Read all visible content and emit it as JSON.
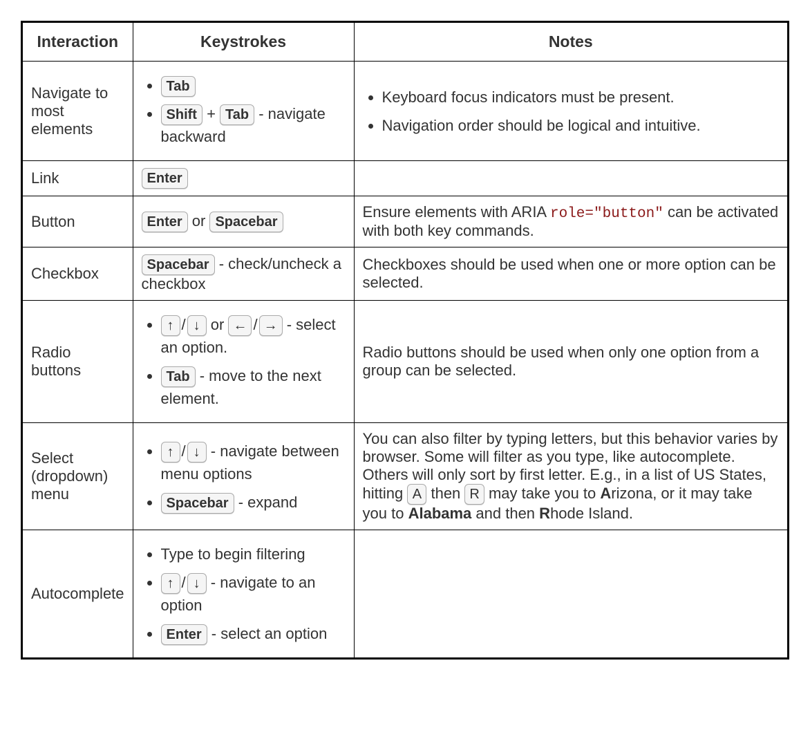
{
  "headers": {
    "interaction": "Interaction",
    "keystrokes": "Keystrokes",
    "notes": "Notes"
  },
  "keys": {
    "tab": "Tab",
    "shift": "Shift",
    "enter": "Enter",
    "spacebar": "Spacebar",
    "up": "↑",
    "down": "↓",
    "left": "←",
    "right": "→",
    "A": "A",
    "R": "R"
  },
  "rows": {
    "r0": {
      "interaction": "Navigate to most elements",
      "k_item2_suffix": " - navigate backward",
      "k_plus": " + ",
      "note1": "Keyboard focus indicators must be present.",
      "note2": "Navigation order should be logical and intuitive."
    },
    "r1": {
      "interaction": "Link"
    },
    "r2": {
      "interaction": "Button",
      "k_or": " or ",
      "note_pre": "Ensure elements with ARIA ",
      "note_code": "role=\"button\"",
      "note_post": " can be activated with both key commands."
    },
    "r3": {
      "interaction": "Checkbox",
      "k_suffix": " - check/uncheck a checkbox",
      "note": "Checkboxes should be used when one or more option can be selected."
    },
    "r4": {
      "interaction": "Radio buttons",
      "k1_or": " or ",
      "k1_suffix": " - select an option.",
      "k2_suffix": " - move to the next element.",
      "slash": "/",
      "note": "Radio buttons should be used when only one option from a group can be selected."
    },
    "r5": {
      "interaction": "Select (dropdown) menu",
      "k1_suffix": " - navigate between menu options",
      "k2_suffix": " - expand",
      "slash": "/",
      "note_p1": "You can also filter by typing letters, but this behavior varies by browser. Some will filter as you type, like autocomplete. Others will only sort by first letter. E.g., in a list of US States, hitting ",
      "note_then": " then ",
      "note_p2": " may take you to ",
      "note_arizona_bold": "A",
      "note_arizona_rest": "rizona, or it may take you to ",
      "note_alabama": "Alabama",
      "note_p3": " and then ",
      "note_rhode_bold": "R",
      "note_rhode_rest": "hode Island."
    },
    "r6": {
      "interaction": "Autocomplete",
      "k1": "Type to begin filtering",
      "k2_suffix": " - navigate to an option",
      "k3_suffix": " - select an option",
      "slash": "/"
    }
  }
}
